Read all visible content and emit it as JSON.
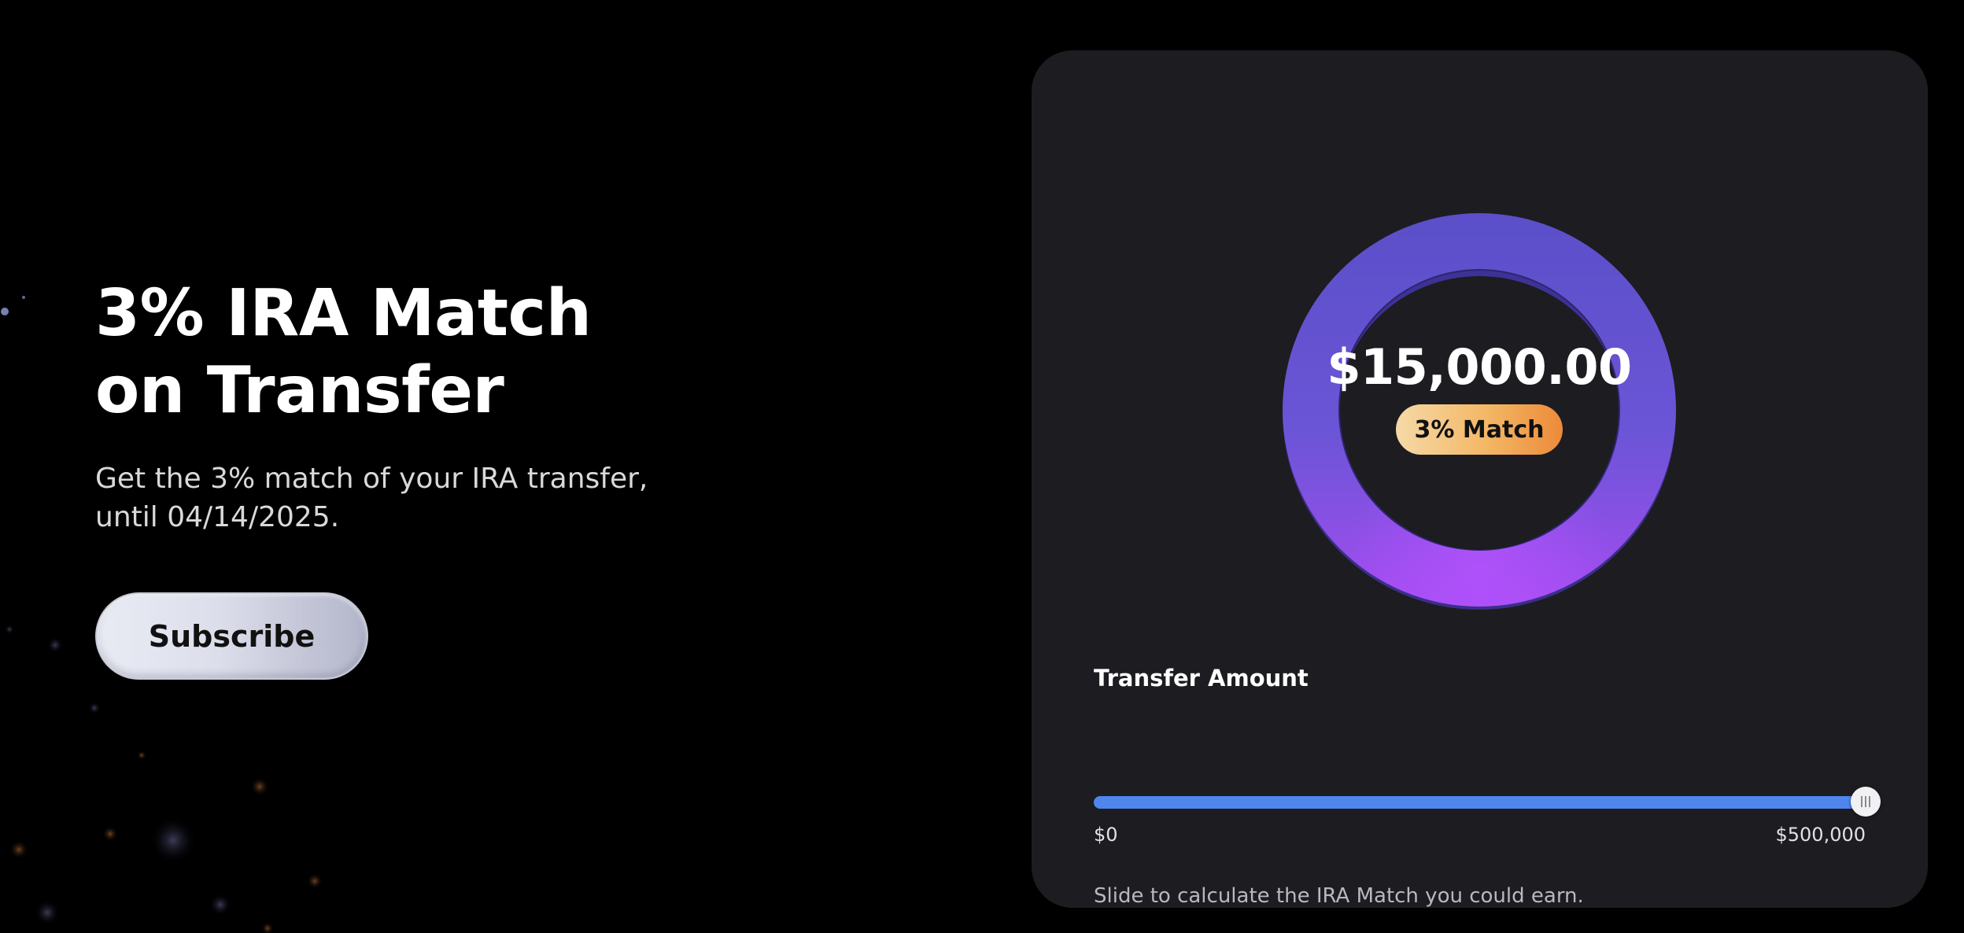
{
  "hero": {
    "title": "3% IRA Match on Transfer",
    "subtitle": "Get the 3% match of your IRA transfer, until 04/14/2025.",
    "cta_label": "Subscribe"
  },
  "calculator": {
    "match_amount": "$15,000.00",
    "match_badge": "3% Match",
    "transfer_label": "Transfer Amount",
    "slider": {
      "min_label": "$0",
      "max_label": "$500,000",
      "min": 0,
      "max": 500000,
      "value": 500000
    },
    "helper_text": "Slide to calculate the IRA Match you could earn."
  },
  "colors": {
    "background": "#000000",
    "card": "#1d1c21",
    "ring_top": "#5b4fc9",
    "ring_bottom": "#a54cf0",
    "slider_fill": "#4f86ee",
    "badge_start": "#f6d9a7",
    "badge_end": "#ec8a3a"
  }
}
